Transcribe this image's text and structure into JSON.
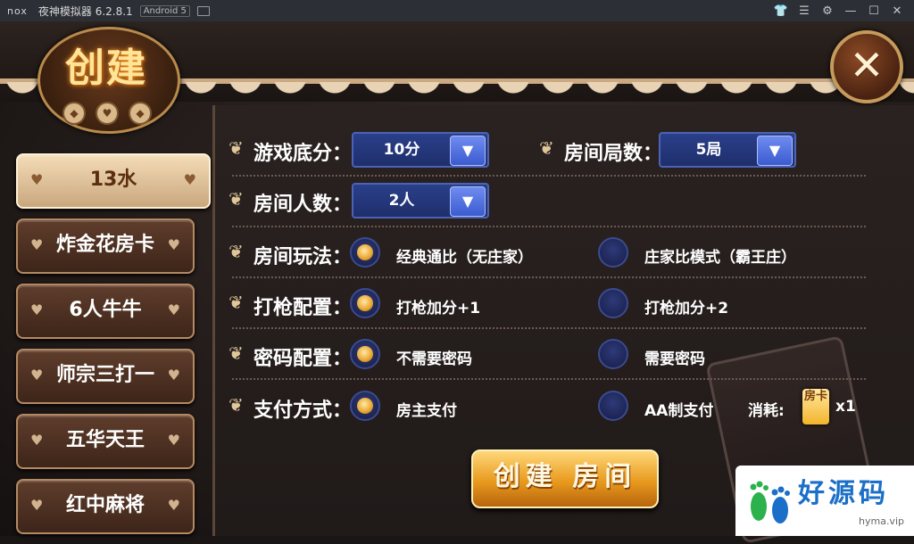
{
  "titlebar": {
    "logo": "nox",
    "title": "夜神模拟器 6.2.8.1",
    "badge": "Android 5",
    "controls": [
      "shirt-icon",
      "menu-icon",
      "gear-icon",
      "minimize-icon",
      "maximize-icon",
      "close-icon"
    ]
  },
  "header": {
    "emblem_title": "创建",
    "emblem_icons": [
      "diamond-suit-icon",
      "heart-suit-icon",
      "club-suit-icon"
    ],
    "close_label": "✕"
  },
  "sidebar": {
    "items": [
      {
        "label": "13水",
        "active": true
      },
      {
        "label": "炸金花房卡",
        "active": false
      },
      {
        "label": "6人牛牛",
        "active": false
      },
      {
        "label": "师宗三打一",
        "active": false
      },
      {
        "label": "五华天王",
        "active": false
      },
      {
        "label": "红中麻将",
        "active": false
      }
    ]
  },
  "form": {
    "base_score": {
      "label": "游戏底分：",
      "value": "10分"
    },
    "rounds": {
      "label": "房间局数：",
      "value": "5局"
    },
    "players": {
      "label": "房间人数：",
      "value": "2人"
    },
    "play_mode": {
      "label": "房间玩法：",
      "options": [
        "经典通比（无庄家）",
        "庄家比模式（霸王庄）"
      ],
      "selected": 0
    },
    "gun": {
      "label": "打枪配置：",
      "options": [
        "打枪加分+1",
        "打枪加分+2"
      ],
      "selected": 0
    },
    "password": {
      "label": "密码配置：",
      "options": [
        "不需要密码",
        "需要密码"
      ],
      "selected": 0
    },
    "payment": {
      "label": "支付方式：",
      "options": [
        "房主支付",
        "AA制支付"
      ],
      "selected": 0
    },
    "cost": {
      "label": "消耗:",
      "card": "房卡",
      "quantity": "x1"
    }
  },
  "actions": {
    "create_label": "创建 房间"
  },
  "watermark": {
    "text": "好源码",
    "url": "hyma.vip"
  },
  "colors": {
    "accent_blue": "#2a3f8a",
    "gold": "#e89a1e",
    "panel_bg": "#231c1a"
  }
}
